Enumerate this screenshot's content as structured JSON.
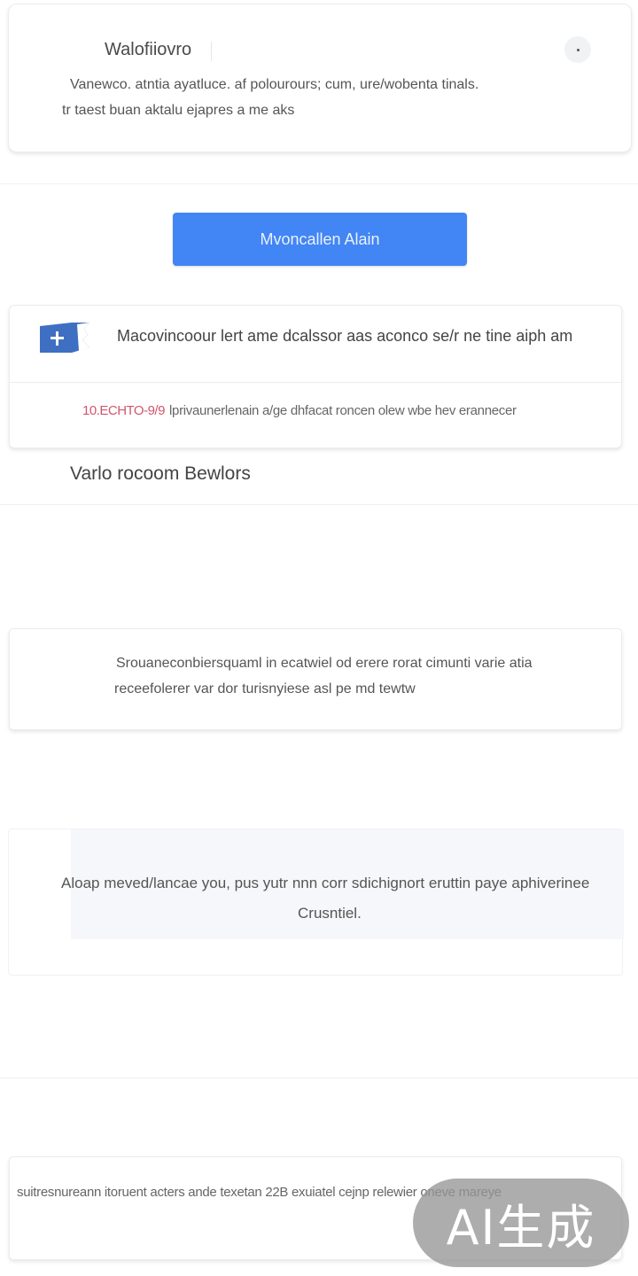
{
  "header": {
    "title": "Walofiiovro",
    "body_line1": "Vanewco. atntia ayatluce. af polourours; cum, ure/wobenta tinals.",
    "body_line2": "tr taest buan aktalu ejapres a me aks",
    "close_icon": "dot-close-icon"
  },
  "primary_button": {
    "label": "Mvoncallen Alain",
    "color": "#4285f4"
  },
  "info_card": {
    "icon": "ticket-plus-icon",
    "icon_color": "#3f6fc2",
    "line1": "Macovincoour lert ame dcalssor aas aconco se/r ne tine aiph am",
    "code": "10.ECHTO-9/9",
    "line2": "lprivaunerlenain a/ge dhfacat roncen olew wbe hev erannecer"
  },
  "section": {
    "heading": "Varlo rocoom Bewlors"
  },
  "description_card": {
    "line1": "Srouaneconbiersquaml in ecatwiel od erere rorat cimunti varie atia",
    "line2": "receefolerer var dor turisnyiese asl pe md tewtw"
  },
  "notice": {
    "line1": "Aloap meved/lancae you, pus yutr nnn corr sdichignort eruttin paye aphiverinee",
    "line2": "Crusntiel."
  },
  "footer_card": {
    "line": "suitresnureann itoruent acters ande texetan 22B exuiatel cejnp relewier oneve mareye"
  },
  "watermark": {
    "text": "AI生成"
  }
}
